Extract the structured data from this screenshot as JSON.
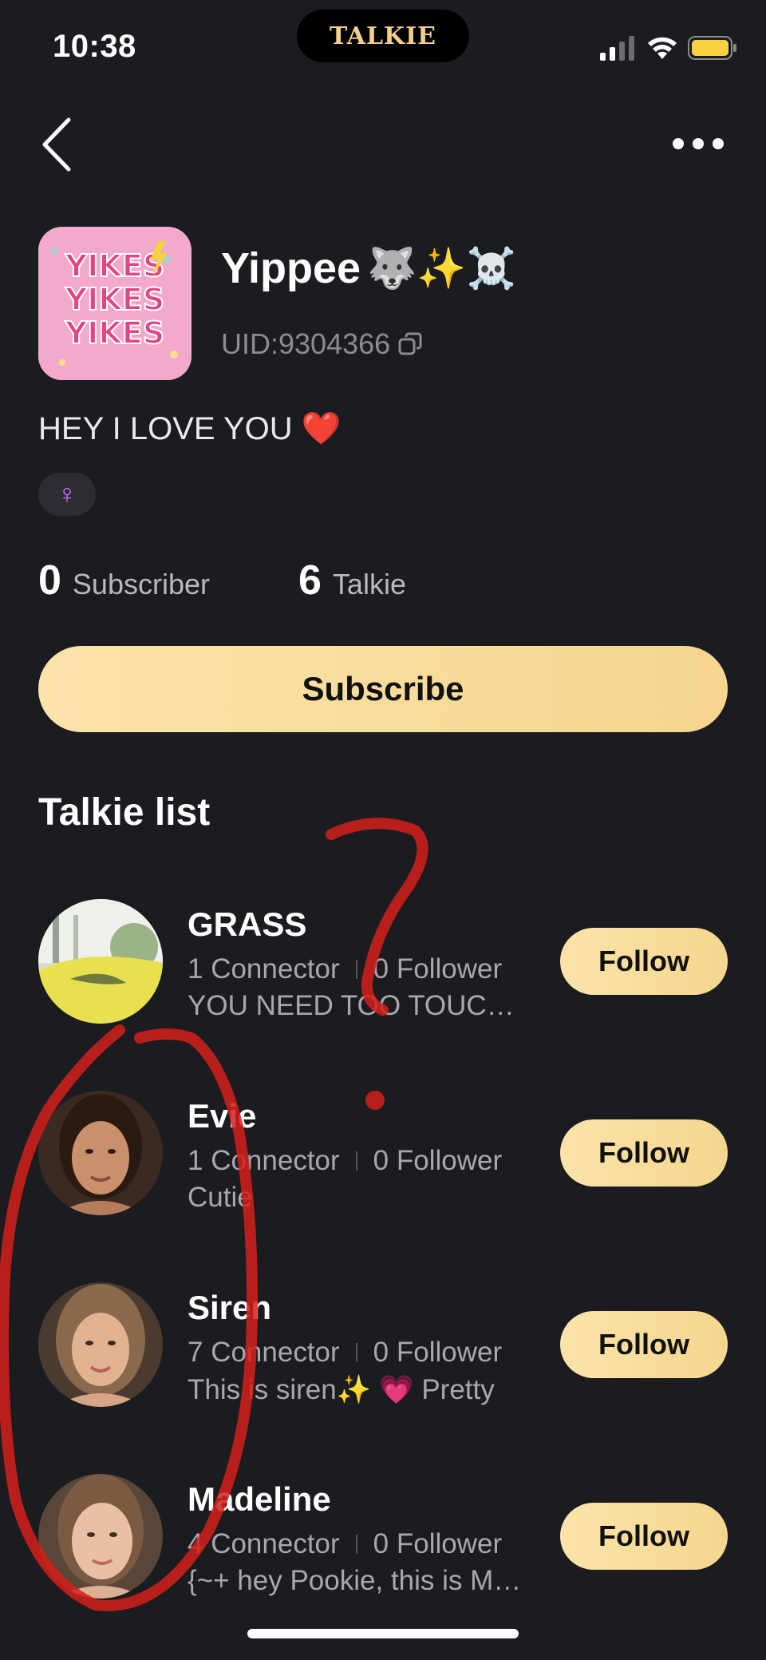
{
  "status_bar": {
    "time": "10:38",
    "island_logo": "TALKIE"
  },
  "profile": {
    "name": "Yippee",
    "name_emojis": "🐺✨☠️",
    "uid": "UID:9304366",
    "avatar_text": "YIKES",
    "bio": "HEY I LOVE YOU ❤️",
    "gender_symbol": "♀",
    "subscriber_count": "0",
    "subscriber_label": "Subscriber",
    "talkie_count": "6",
    "talkie_label": "Talkie",
    "subscribe_label": "Subscribe"
  },
  "talkie_list": {
    "title": "Talkie list",
    "items": [
      {
        "name": "GRASS",
        "connector": "1 Connector",
        "follower": "0 Follower",
        "desc": "YOU NEED  TOO  TOUCH GRASS",
        "follow_label": "Follow",
        "avatar": "landscape-avatar"
      },
      {
        "name": "Evie",
        "connector": "1 Connector",
        "follower": "0 Follower",
        "desc": "Cutie",
        "follow_label": "Follow",
        "avatar": "woman-avatar"
      },
      {
        "name": "Siren",
        "connector": "7 Connector",
        "follower": "0 Follower",
        "desc": "This is siren✨ 💗 Pretty",
        "follow_label": "Follow",
        "avatar": "woman-avatar"
      },
      {
        "name": "Madeline",
        "connector": "4 Connector",
        "follower": "0 Follower",
        "desc": "{~+ hey Pookie, this is Madeline",
        "follow_label": "Follow",
        "avatar": "woman-avatar"
      }
    ]
  },
  "colors": {
    "background": "#1b1c20",
    "accent": "#f6d68e",
    "annotation": "#d4201a"
  }
}
